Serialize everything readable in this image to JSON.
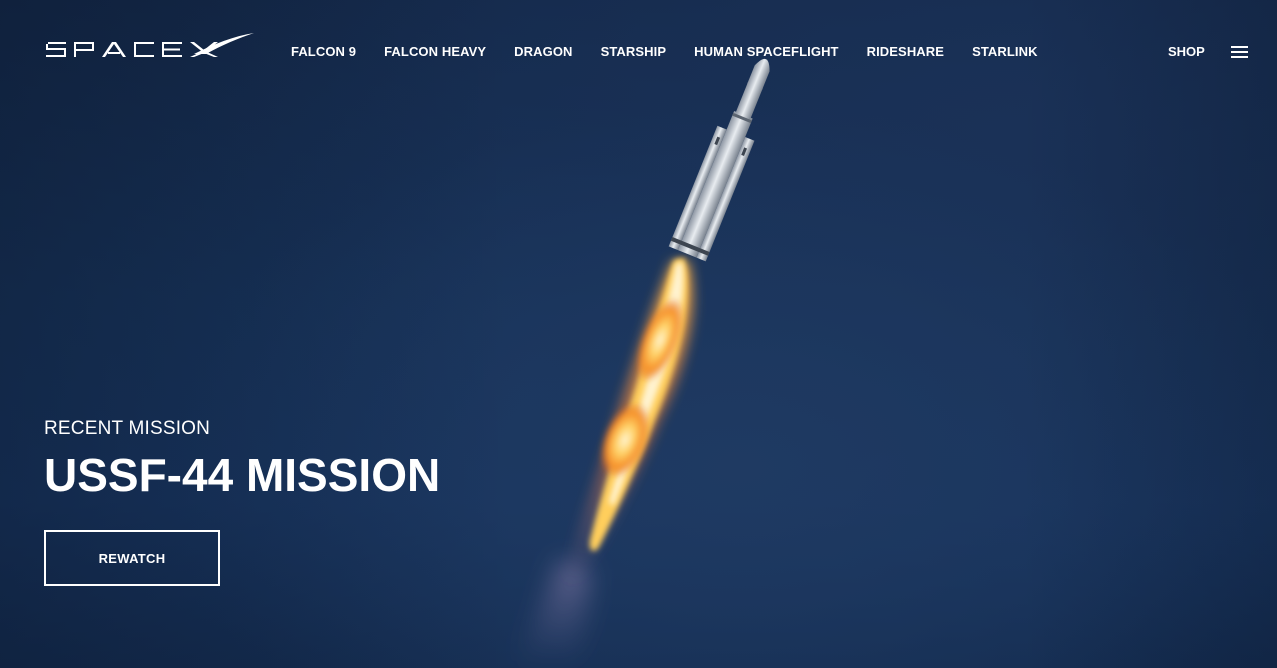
{
  "brand": {
    "logo_text": "SPACEX",
    "logo_icon": "spacex-swoosh-logo"
  },
  "nav": {
    "items": [
      {
        "label": "FALCON 9"
      },
      {
        "label": "FALCON HEAVY"
      },
      {
        "label": "DRAGON"
      },
      {
        "label": "STARSHIP"
      },
      {
        "label": "HUMAN SPACEFLIGHT"
      },
      {
        "label": "RIDESHARE"
      },
      {
        "label": "STARLINK"
      }
    ],
    "shop_label": "SHOP",
    "menu_icon": "hamburger-menu-icon"
  },
  "hero": {
    "eyebrow": "RECENT MISSION",
    "title": "USSF-44 MISSION",
    "cta_label": "REWATCH",
    "background_image": "rocket-launch-photo",
    "colors": {
      "sky": "#17335a",
      "text": "#ffffff"
    }
  }
}
